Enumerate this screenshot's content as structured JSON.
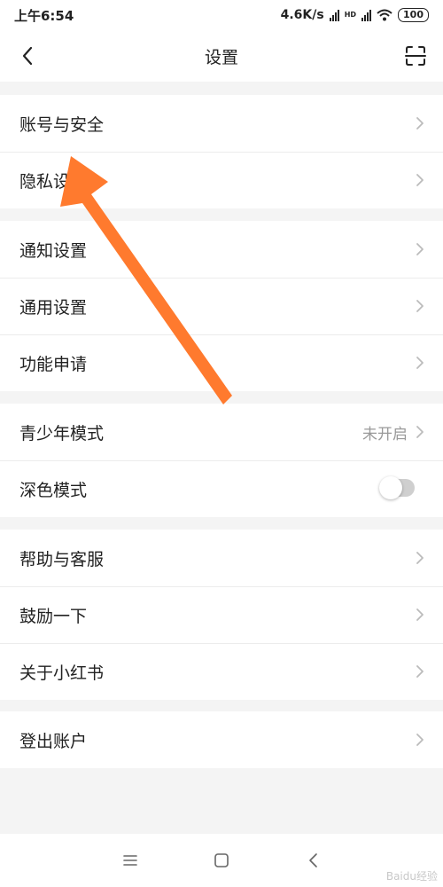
{
  "status_bar": {
    "time": "上午6:54",
    "network_speed": "4.6K/s",
    "hd_label": "HD",
    "battery": "100"
  },
  "header": {
    "title": "设置",
    "back_icon": "chevron-left-icon",
    "scan_icon": "scan-icon"
  },
  "groups": [
    {
      "items": [
        {
          "label": "账号与安全"
        },
        {
          "label": "隐私设置"
        }
      ]
    },
    {
      "items": [
        {
          "label": "通知设置"
        },
        {
          "label": "通用设置"
        },
        {
          "label": "功能申请"
        }
      ]
    },
    {
      "items": [
        {
          "label": "青少年模式",
          "value": "未开启"
        },
        {
          "label": "深色模式",
          "toggle_on": false
        }
      ]
    },
    {
      "items": [
        {
          "label": "帮助与客服"
        },
        {
          "label": "鼓励一下"
        },
        {
          "label": "关于小红书"
        }
      ]
    },
    {
      "items": [
        {
          "label": "登出账户"
        }
      ]
    }
  ],
  "annotation": {
    "arrow_color": "#ff7a2e"
  },
  "watermark": "Baidu经验"
}
